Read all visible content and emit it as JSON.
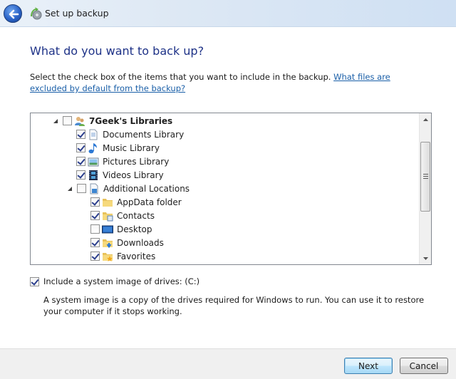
{
  "window": {
    "title": "Set up backup",
    "back_icon": "back-arrow-icon",
    "app_icon": "backup-icon"
  },
  "page": {
    "heading": "What do you want to back up?",
    "intro_text": "Select the check box of the items that you want to include in the backup.",
    "intro_link": "What files are excluded by default from the backup?"
  },
  "tree": {
    "items": [
      {
        "label": "7Geek's Libraries",
        "checked": false,
        "expanded": true,
        "level": 0,
        "icon": "user-libraries-icon",
        "bold": true
      },
      {
        "label": "Documents Library",
        "checked": true,
        "level": 1,
        "icon": "document-icon"
      },
      {
        "label": "Music Library",
        "checked": true,
        "level": 1,
        "icon": "music-note-icon"
      },
      {
        "label": "Pictures Library",
        "checked": true,
        "level": 1,
        "icon": "picture-icon"
      },
      {
        "label": "Videos Library",
        "checked": true,
        "level": 1,
        "icon": "film-icon"
      },
      {
        "label": "Additional Locations",
        "checked": false,
        "expanded": true,
        "level": 1,
        "icon": "locations-icon"
      },
      {
        "label": "AppData folder",
        "checked": true,
        "level": 2,
        "icon": "folder-icon"
      },
      {
        "label": "Contacts",
        "checked": true,
        "level": 2,
        "icon": "contacts-folder-icon"
      },
      {
        "label": "Desktop",
        "checked": false,
        "level": 2,
        "icon": "desktop-icon"
      },
      {
        "label": "Downloads",
        "checked": true,
        "level": 2,
        "icon": "downloads-folder-icon"
      },
      {
        "label": "Favorites",
        "checked": true,
        "level": 2,
        "icon": "favorites-folder-icon"
      }
    ]
  },
  "system_image": {
    "label": "Include a system image of drives: (C:)",
    "checked": true,
    "description": "A system image is a copy of the drives required for Windows to run. You can use it to restore your computer if it stops working."
  },
  "buttons": {
    "next": "Next",
    "cancel": "Cancel"
  }
}
